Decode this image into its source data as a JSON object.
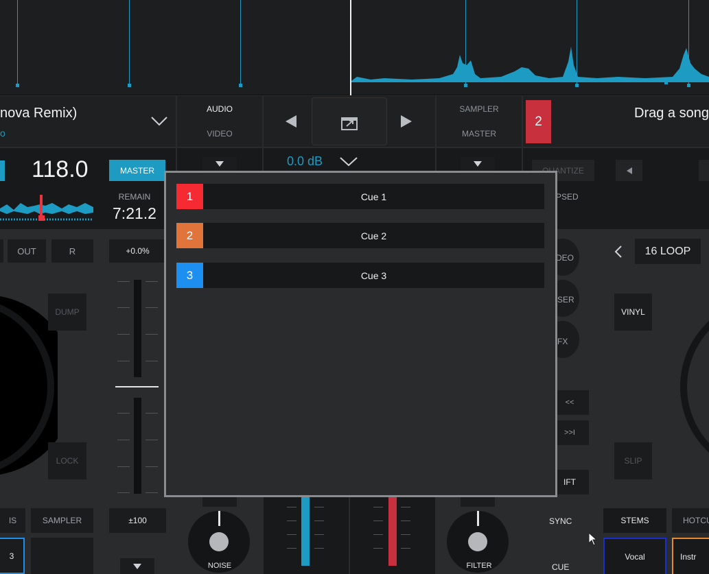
{
  "deck_left": {
    "title_partial": "nova Remix)",
    "artist_partial": "o",
    "bpm": "118.0",
    "master_label": "MASTER",
    "remain_label": "REMAIN",
    "remain_time": "7:21.2",
    "out_label": "OUT",
    "r_label": "R",
    "pitch_value": "+0.0%",
    "dump_label": "DUMP",
    "lock_label": "LOCK",
    "pitch_range": "±100",
    "sampler_label": "SAMPLER",
    "stems_partial": "IS",
    "pad_partial": "3"
  },
  "center": {
    "audio_label": "AUDIO",
    "video_label": "VIDEO",
    "gain_value": "0.0 dB",
    "sampler_label": "SAMPLER",
    "master_label": "MASTER",
    "noise_label": "NOISE",
    "filter_label": "FILTER"
  },
  "deck_right": {
    "deck_number": "2",
    "drag_text": "Drag a song",
    "quantize_label": "QUANTIZE",
    "elapsed_partial": "APSED",
    "loop_label": "16 LOOP",
    "vinyl_label": "VINYL",
    "slip_label": "SLIP",
    "stems_label": "STEMS",
    "hotcue_partial": "HOTCU",
    "pad_vocal": "Vocal",
    "pad_instr_partial": "Instr",
    "sync_label": "SYNC",
    "cue_label": "CUE",
    "video_partial": "DEO",
    "laser_partial": "SER",
    "fx_partial": "FX",
    "rew_partial": "<<",
    "fwd_partial": ">>I",
    "shift_partial": "IFT"
  },
  "cue_modal": {
    "cues": [
      {
        "number": "1",
        "label": "Cue 1",
        "color": "#f52a33"
      },
      {
        "number": "2",
        "label": "Cue 2",
        "color": "#e0743a"
      },
      {
        "number": "3",
        "label": "Cue 3",
        "color": "#1c8ff0"
      }
    ]
  },
  "colors": {
    "accent_blue": "#1e9bc2",
    "deck2_red": "#c9303d"
  }
}
